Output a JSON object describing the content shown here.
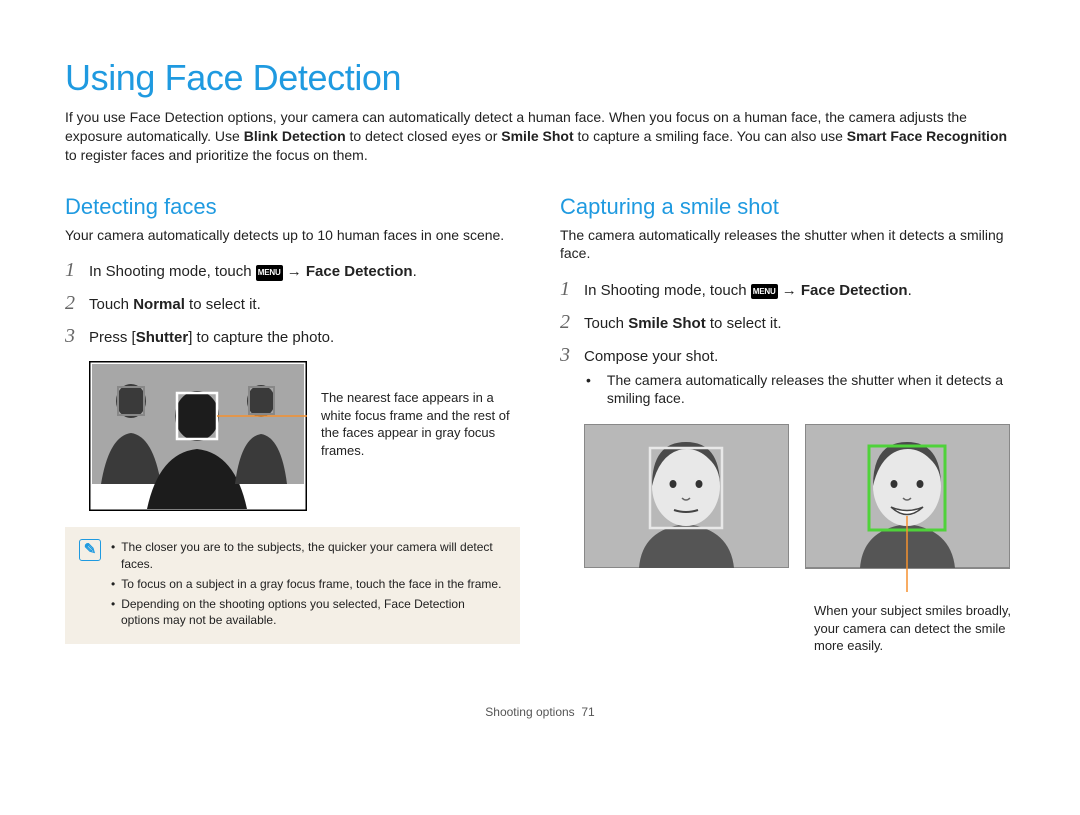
{
  "title": "Using Face Detection",
  "intro": {
    "t1": "If you use Face Detection options, your camera can automatically detect a human face. When you focus on a human face, the camera adjusts the exposure automatically. Use ",
    "b1": "Blink Detection",
    "t2": " to detect closed eyes or ",
    "b2": "Smile Shot",
    "t3": " to capture a smiling face. You can also use ",
    "b3": "Smart Face Recognition",
    "t4": " to register faces and prioritize the focus on them."
  },
  "left": {
    "heading": "Detecting faces",
    "lead": "Your camera automatically detects up to 10 human faces in one scene.",
    "step1": {
      "pre": "In Shooting mode, touch ",
      "menu": "MENU",
      "arrow": " → ",
      "target": "Face Detection",
      "post": "."
    },
    "step2": {
      "pre": "Touch ",
      "bold": "Normal",
      "post": " to select it."
    },
    "step3": {
      "pre": "Press [",
      "bold": "Shutter",
      "post": "] to capture the photo."
    },
    "figcap": "The nearest face appears in a white focus frame and the rest of the faces appear in gray focus frames.",
    "notes": [
      "The closer you are to the subjects, the quicker your camera will detect faces.",
      "To focus on a subject in a gray focus frame, touch the face in the frame.",
      "Depending on the shooting options you selected, Face Detection options may not be available."
    ]
  },
  "right": {
    "heading": "Capturing a smile shot",
    "lead": "The camera automatically releases the shutter when it detects a smiling face.",
    "step1": {
      "pre": "In Shooting mode, touch ",
      "menu": "MENU",
      "arrow": " → ",
      "target": "Face Detection",
      "post": "."
    },
    "step2": {
      "pre": "Touch ",
      "bold": "Smile Shot",
      "post": " to select it."
    },
    "step3text": "Compose your shot.",
    "step3bullet": "The camera automatically releases the shutter when it detects a smiling face.",
    "smilecap": "When your subject smiles broadly, your camera can detect the smile more easily."
  },
  "footer": {
    "section": "Shooting options",
    "page": "71"
  }
}
